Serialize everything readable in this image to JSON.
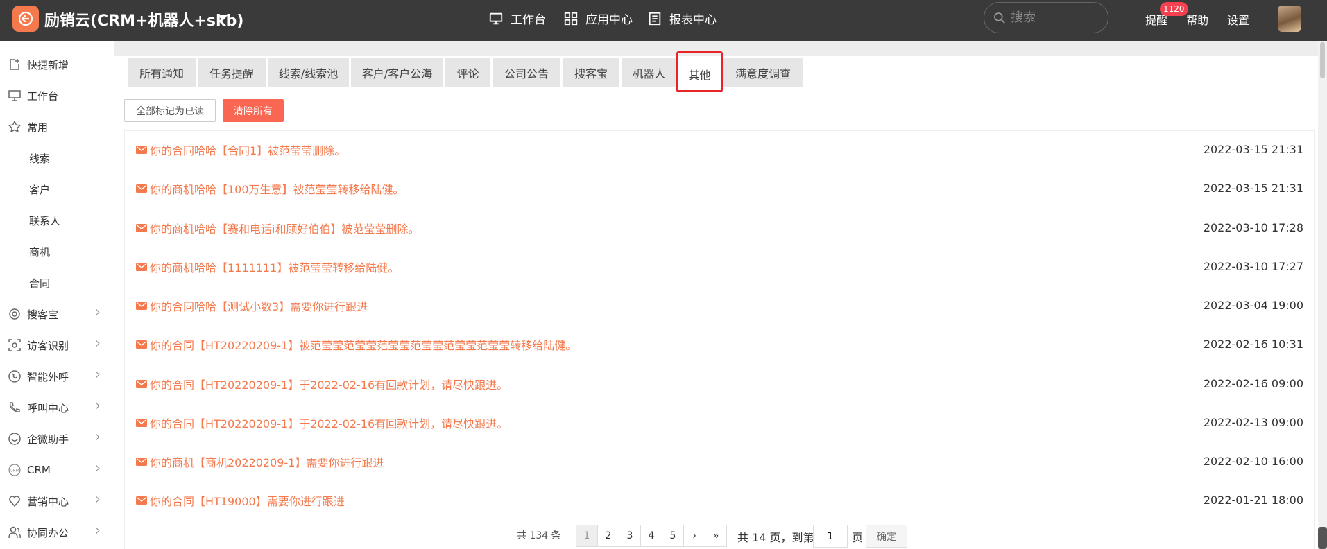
{
  "app": {
    "title": "励销云(CRM+机器人+skb)"
  },
  "topnav": {
    "workbench": "工作台",
    "apps": "应用中心",
    "reports": "报表中心"
  },
  "search": {
    "placeholder": "搜索"
  },
  "header_links": {
    "remind": "提醒",
    "remind_badge": "1120",
    "help": "帮助",
    "settings": "设置"
  },
  "sidebar": {
    "items": [
      {
        "label": "快捷新增",
        "icon": "add-file-icon"
      },
      {
        "label": "工作台",
        "icon": "monitor-icon"
      },
      {
        "label": "常用",
        "icon": "star-icon"
      },
      {
        "label": "线索"
      },
      {
        "label": "客户"
      },
      {
        "label": "联系人"
      },
      {
        "label": "商机"
      },
      {
        "label": "合同"
      },
      {
        "label": "搜客宝",
        "icon": "search-treasure-icon"
      },
      {
        "label": "访客识别",
        "icon": "visitor-icon"
      },
      {
        "label": "智能外呼",
        "icon": "phone-icon"
      },
      {
        "label": "呼叫中心",
        "icon": "call-icon"
      },
      {
        "label": "企微助手",
        "icon": "wechat-icon"
      },
      {
        "label": "CRM",
        "icon": "crm-icon"
      },
      {
        "label": "营销中心",
        "icon": "marketing-icon"
      },
      {
        "label": "协同办公",
        "icon": "people-icon"
      }
    ]
  },
  "tabs": [
    "所有通知",
    "任务提醒",
    "线索/线索池",
    "客户/客户公海",
    "评论",
    "公司公告",
    "搜客宝",
    "机器人",
    "其他",
    "满意度调查"
  ],
  "active_tab": "其他",
  "actions": {
    "mark_all_read": "全部标记为已读",
    "clear_all": "清除所有"
  },
  "notices": [
    {
      "text": "你的合同哈哈【合同1】被范莹莹删除。",
      "time": "2022-03-15 21:31"
    },
    {
      "text": "你的商机哈哈【100万生意】被范莹莹转移给陆健。",
      "time": "2022-03-15 21:31"
    },
    {
      "text": "你的商机哈哈【赛和电话i和顾好伯伯】被范莹莹删除。",
      "time": "2022-03-10 17:28"
    },
    {
      "text": "你的商机哈哈【1111111】被范莹莹转移给陆健。",
      "time": "2022-03-10 17:27"
    },
    {
      "text": "你的合同哈哈【测试小数3】需要你进行跟进",
      "time": "2022-03-04 19:00"
    },
    {
      "text": "你的合同【HT20220209-1】被范莹莹范莹莹范莹莹范莹莹范莹莹范莹莹转移给陆健。",
      "time": "2022-02-16 10:31"
    },
    {
      "text": "你的合同【HT20220209-1】于2022-02-16有回款计划，请尽快跟进。",
      "time": "2022-02-16 09:00"
    },
    {
      "text": "你的合同【HT20220209-1】于2022-02-16有回款计划，请尽快跟进。",
      "time": "2022-02-13 09:00"
    },
    {
      "text": "你的商机【商机20220209-1】需要你进行跟进",
      "time": "2022-02-10 16:00"
    },
    {
      "text": "你的合同【HT19000】需要你进行跟进",
      "time": "2022-01-21 18:00"
    }
  ],
  "pagination": {
    "total": "共 134 条",
    "pages": [
      "1",
      "2",
      "3",
      "4",
      "5"
    ],
    "current": "1",
    "next": "›",
    "last": "»",
    "pages_total": "共 14 页，到第",
    "goto_value": "1",
    "page_unit": "页",
    "confirm": "确定"
  },
  "colors": {
    "accent": "#f47a4d",
    "clear_button": "#f96652",
    "topbar": "#3a3a3a",
    "badge": "#f4404f",
    "highlight": "#e8242b"
  }
}
